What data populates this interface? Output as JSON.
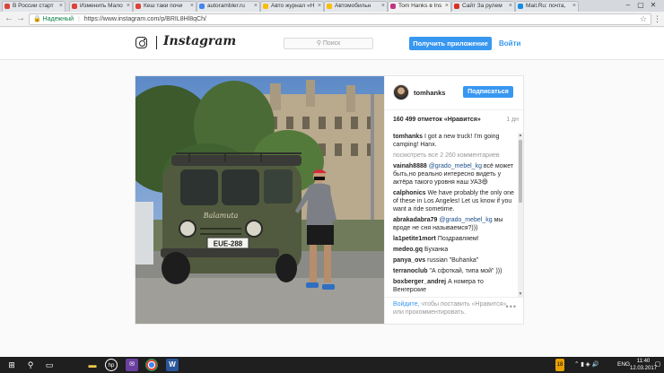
{
  "browser": {
    "tabs": [
      {
        "label": "В России старт",
        "color": "#db4437",
        "active": false
      },
      {
        "label": "Изменить Мало",
        "color": "#db4437",
        "active": false
      },
      {
        "label": "Кеш таки почи",
        "color": "#db4437",
        "active": false
      },
      {
        "label": "autorambler.ru",
        "color": "#4285f4",
        "active": false
      },
      {
        "label": "Авто журнал «Н",
        "color": "#fbbc05",
        "active": false
      },
      {
        "label": "Автомобильн",
        "color": "#fbbc05",
        "active": false
      },
      {
        "label": "Tom Hanks в Ins",
        "color": "#c13584",
        "active": true
      },
      {
        "label": "Сайт За рулем",
        "color": "#d93025",
        "active": false
      },
      {
        "label": "Mail.Ru: почта,",
        "color": "#168de2",
        "active": false
      }
    ],
    "secure_label": "Надежный",
    "url": "https://www.instagram.com/p/BRIL8Hl8qCh/"
  },
  "header": {
    "wordmark": "Instagram",
    "search_placeholder": "Поиск",
    "get_app_label": "Получить приложение",
    "login_label": "Войти"
  },
  "post": {
    "username": "tomhanks",
    "follow_label": "Подписаться",
    "likes": "160 499 отметок «Нравится»",
    "time": "1 дн",
    "plate": "EUE-288",
    "van_script": "Balamuta",
    "caption": {
      "user": "tomhanks",
      "text": "I got a new truck! I'm going camping! Hanx."
    },
    "more_comments": "посмотреть все 2 260 комментариев",
    "comments": [
      {
        "user": "vainah8888",
        "mention": "@grado_mebel_kg",
        "text": "всё может быть,но реально интересно видеть у актёра такого уровня наш УАЗ😄"
      },
      {
        "user": "calphonics",
        "mention": "",
        "text": "We have probably the only one of these in Los Angeles! Let us know if you want a ride sometime."
      },
      {
        "user": "abrakadabra79",
        "mention": "@grado_mebel_kg",
        "text": "мы вроде не сня называемся?)))"
      },
      {
        "user": "la1petite1mort",
        "mention": "",
        "text": "Поздравляем!"
      },
      {
        "user": "medeo.gq",
        "mention": "",
        "text": "Буханка"
      },
      {
        "user": "panya_ovs",
        "mention": "",
        "text": "russian \"Buhanka\""
      },
      {
        "user": "terranoclub",
        "mention": "",
        "text": "\"А сфоткай, типа мой\" )))"
      },
      {
        "user": "boxberger_andrej",
        "mention": "",
        "text": "А номера то Венгерские"
      }
    ],
    "footer_login": "Войдите,",
    "footer_text": " чтобы поставить «Нравится» или прокомментировать.",
    "footer_more": "•••"
  },
  "taskbar": {
    "lang": "ENG",
    "time": "11:40",
    "date": "12.03.2017",
    "badge": "18"
  }
}
